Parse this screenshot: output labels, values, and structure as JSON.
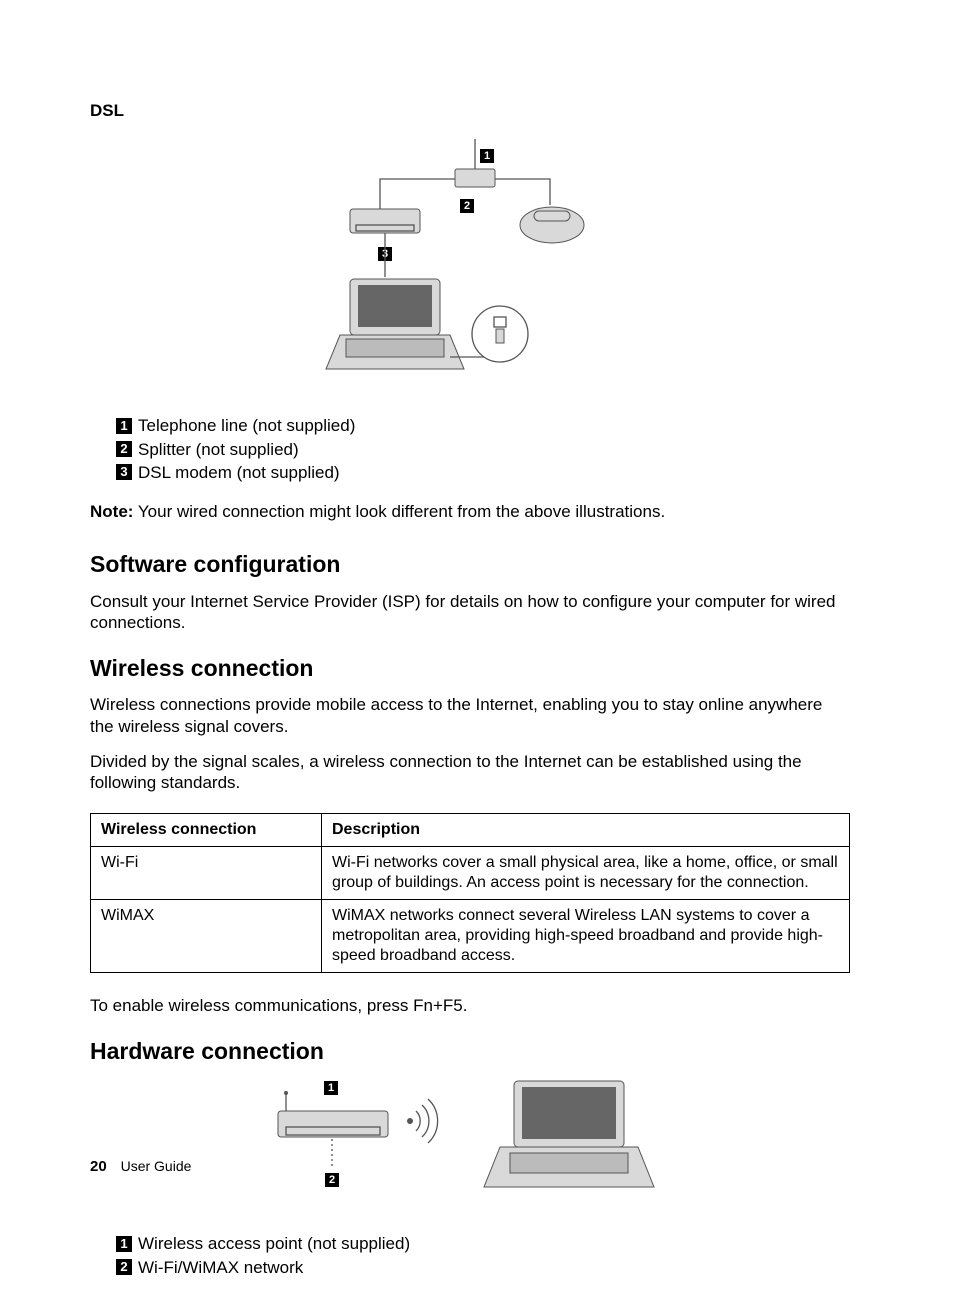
{
  "dsl": {
    "title": "DSL",
    "legend": [
      "Telephone line (not supplied)",
      "Splitter (not supplied)",
      "DSL modem (not supplied)"
    ],
    "note_label": "Note:",
    "note_text": "Your wired connection might look different from the above illustrations."
  },
  "software": {
    "heading": "Software configuration",
    "body": "Consult your Internet Service Provider (ISP) for details on how to configure your computer for wired connections."
  },
  "wireless": {
    "heading": "Wireless connection",
    "intro1": "Wireless connections provide mobile access to the Internet, enabling you to stay online anywhere the wireless signal covers.",
    "intro2": "Divided by the signal scales, a wireless connection to the Internet can be established using the following standards.",
    "table": {
      "col1": "Wireless connection",
      "col2": "Description",
      "rows": [
        {
          "name": "Wi-Fi",
          "desc": "Wi-Fi networks cover a small physical area, like a home, office, or small group of buildings. An access point is necessary for the connection."
        },
        {
          "name": "WiMAX",
          "desc": "WiMAX networks connect several Wireless LAN systems to cover a metropolitan area, providing high-speed broadband and provide high-speed broadband access."
        }
      ]
    },
    "enable": "To enable wireless communications, press Fn+F5."
  },
  "hardware": {
    "heading": "Hardware connection",
    "legend": [
      "Wireless access point (not supplied)",
      "Wi-Fi/WiMAX network"
    ]
  },
  "footer": {
    "page": "20",
    "title": "User Guide"
  }
}
